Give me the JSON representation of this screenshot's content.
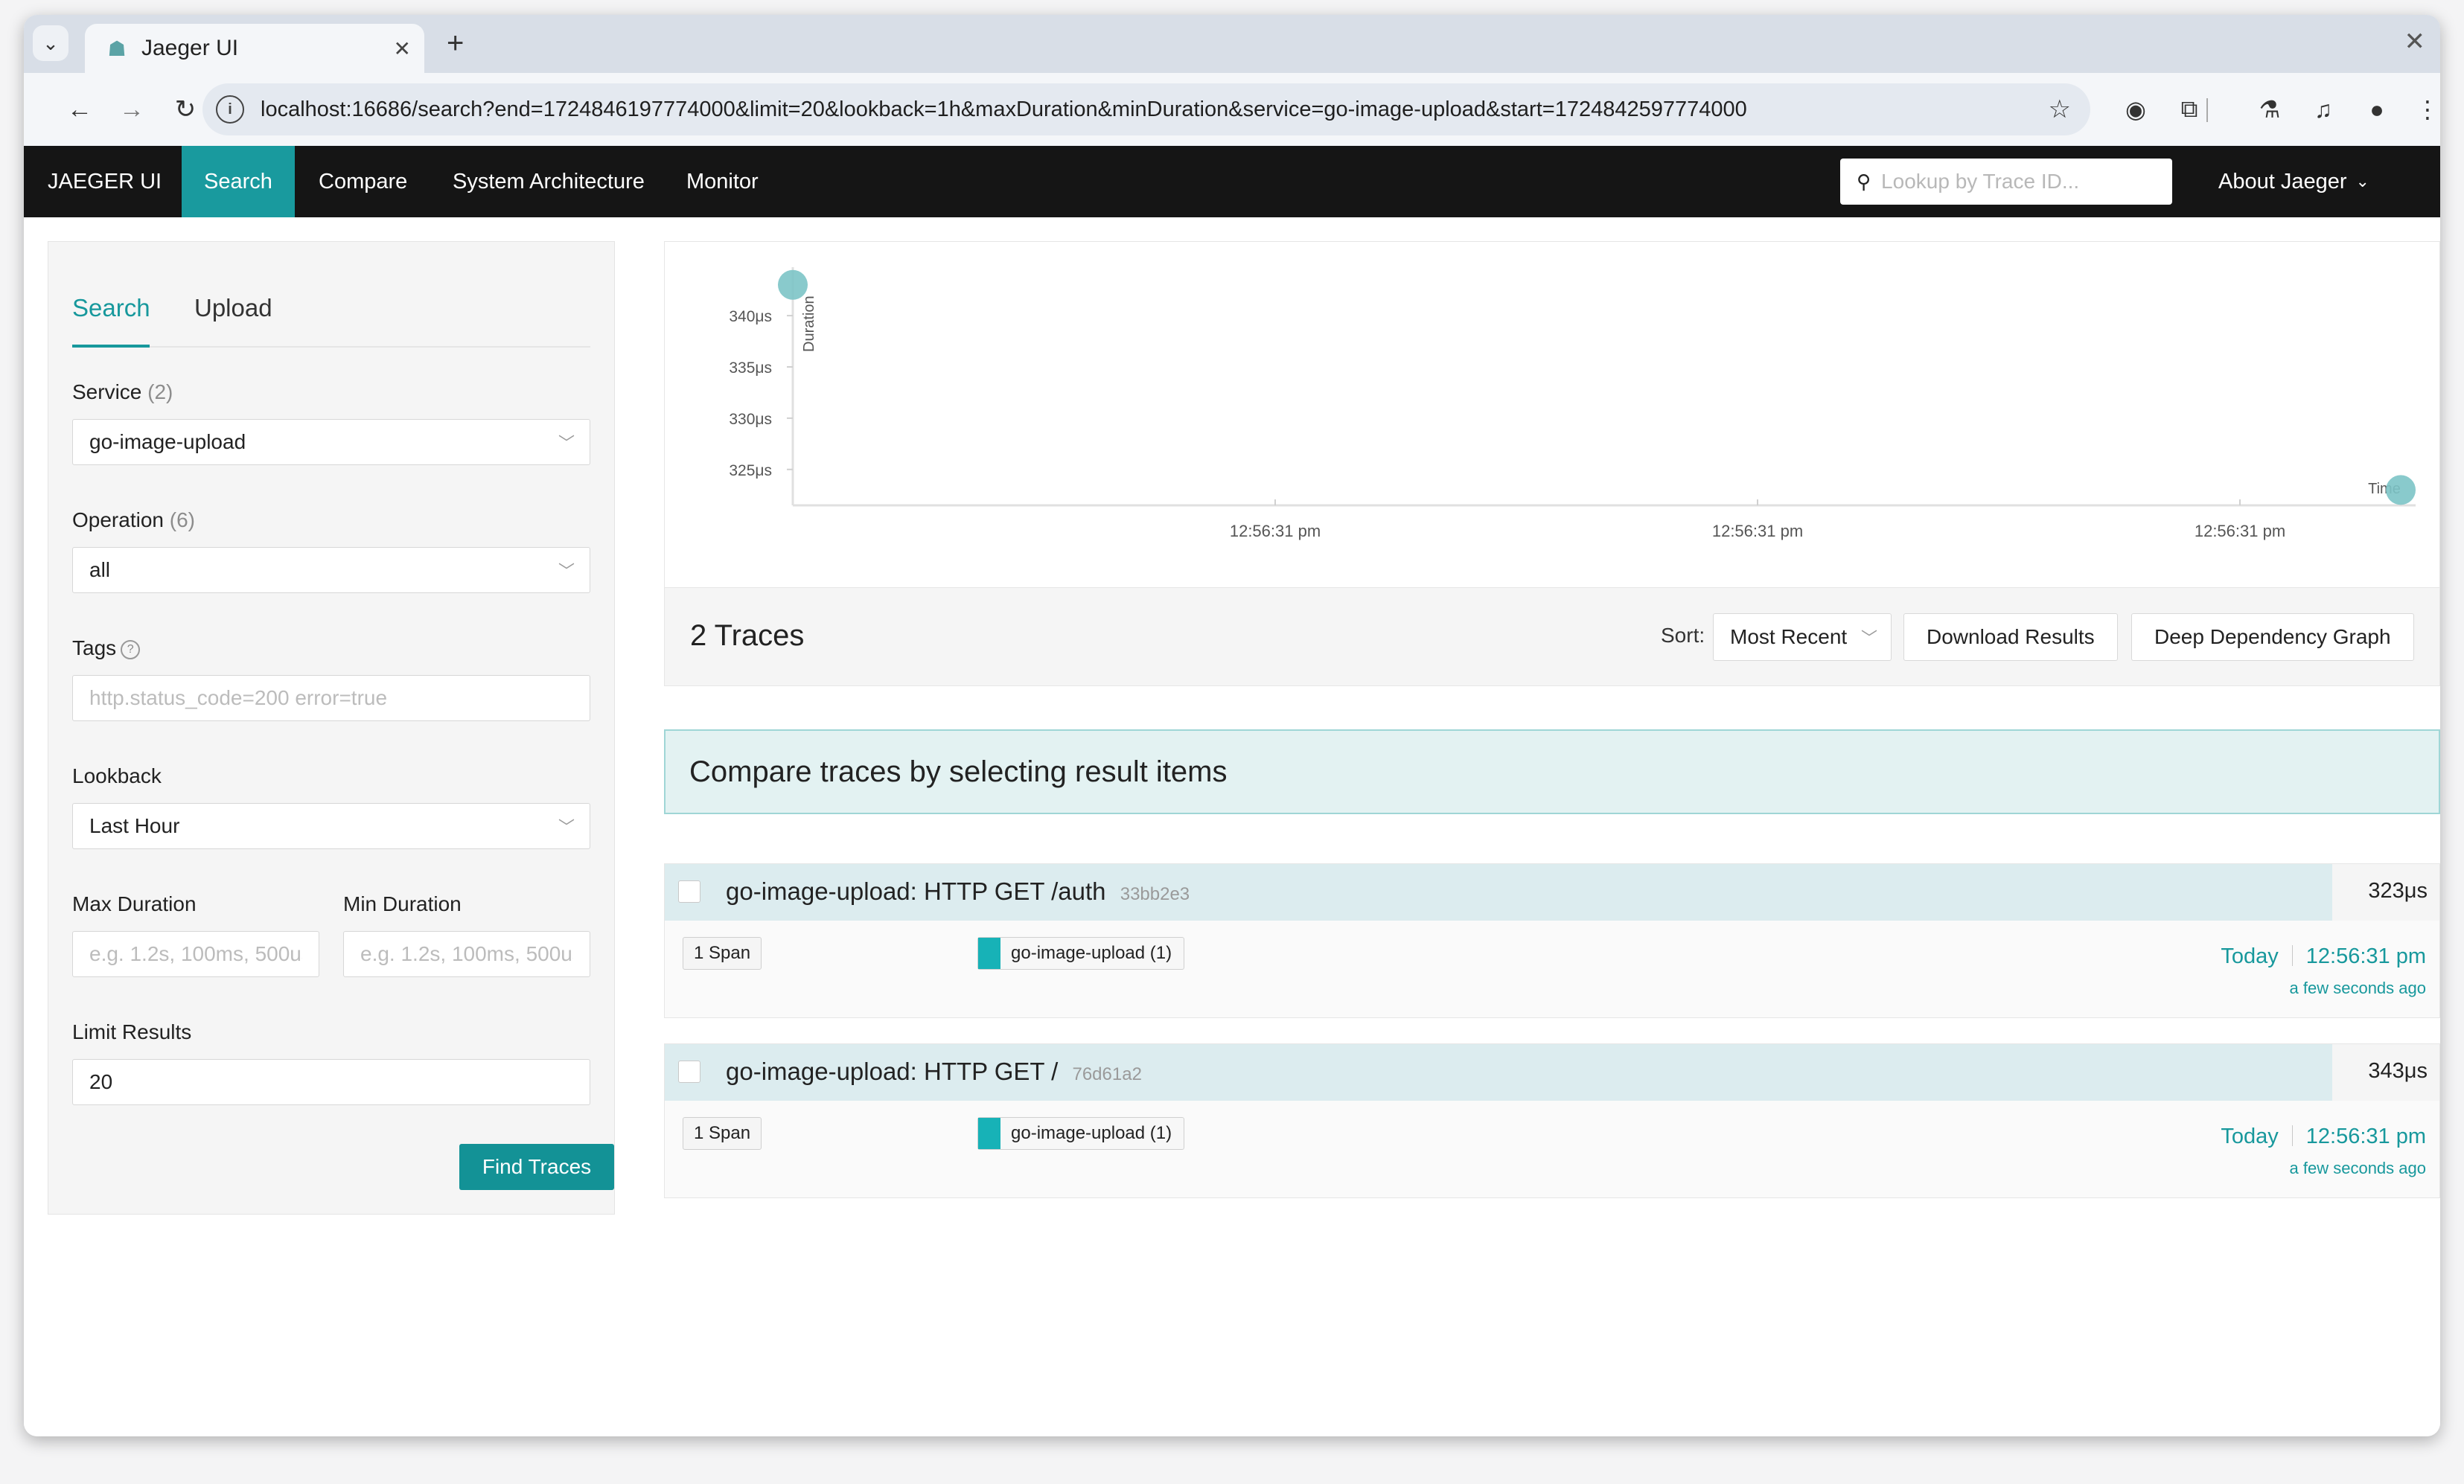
{
  "browser": {
    "tab_title": "Jaeger UI",
    "url": "localhost:16686/search?end=1724846197774000&limit=20&lookback=1h&maxDuration&minDuration&service=go-image-upload&start=1724842597774000",
    "icons": {
      "back": "arrow-left-icon",
      "forward": "arrow-right-icon",
      "reload": "reload-icon",
      "star": "star-icon",
      "extensions": "puzzle-icon",
      "profile": "profile-icon",
      "menu": "kebab-menu-icon"
    }
  },
  "nav": {
    "brand": "JAEGER UI",
    "items": [
      "Search",
      "Compare",
      "System Architecture",
      "Monitor"
    ],
    "active_item": "Search",
    "lookup_placeholder": "Lookup by Trace ID...",
    "about": "About Jaeger"
  },
  "search_form": {
    "tabs": [
      "Search",
      "Upload"
    ],
    "active_tab": "Search",
    "service_label": "Service",
    "service_count": "(2)",
    "service_value": "go-image-upload",
    "operation_label": "Operation",
    "operation_count": "(6)",
    "operation_value": "all",
    "tags_label": "Tags",
    "tags_placeholder": "http.status_code=200 error=true",
    "lookback_label": "Lookback",
    "lookback_value": "Last Hour",
    "max_duration_label": "Max Duration",
    "max_duration_placeholder": "e.g. 1.2s, 100ms, 500us",
    "min_duration_label": "Min Duration",
    "min_duration_placeholder": "e.g. 1.2s, 100ms, 500us",
    "limit_label": "Limit Results",
    "limit_value": "20",
    "find_button": "Find Traces"
  },
  "chart_data": {
    "type": "scatter",
    "ylabel": "Duration",
    "xlabel": "Time",
    "y_ticks": [
      "325μs",
      "330μs",
      "335μs",
      "340μs"
    ],
    "x_ticks": [
      "12:56:31 pm",
      "12:56:31 pm",
      "12:56:31 pm"
    ],
    "ylim": [
      321.5,
      344
    ],
    "points": [
      {
        "x": 0.0,
        "y": 343
      },
      {
        "x": 1.0,
        "y": 323
      }
    ],
    "point_color": "#7cc4c7"
  },
  "results": {
    "count_label": "2 Traces",
    "sort_label": "Sort:",
    "sort_value": "Most Recent",
    "download_button": "Download Results",
    "ddg_button": "Deep Dependency Graph",
    "compare_banner": "Compare traces by selecting result items",
    "traces": [
      {
        "name": "go-image-upload: HTTP GET /auth",
        "id": "33bb2e3",
        "duration": "323μs",
        "spans": "1 Span",
        "service": "go-image-upload (1)",
        "day": "Today",
        "time": "12:56:31 pm",
        "ago": "a few seconds ago"
      },
      {
        "name": "go-image-upload: HTTP GET /",
        "id": "76d61a2",
        "duration": "343μs",
        "spans": "1 Span",
        "service": "go-image-upload (1)",
        "day": "Today",
        "time": "12:56:31 pm",
        "ago": "a few seconds ago"
      }
    ]
  }
}
